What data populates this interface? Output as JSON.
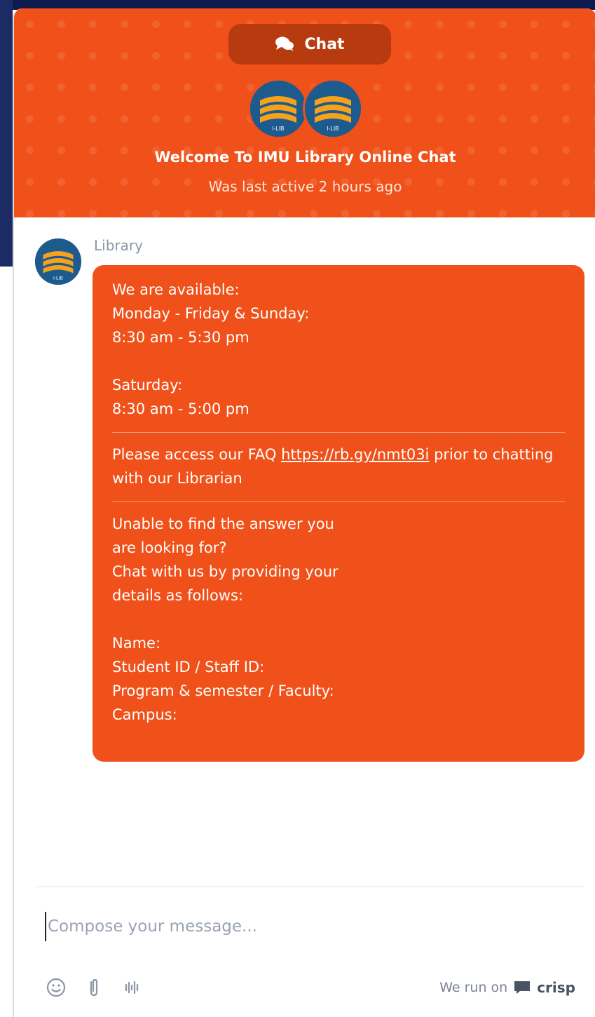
{
  "header": {
    "tab_label": "Chat",
    "title": "Welcome To IMU Library Online Chat",
    "status": "Was last active 2 hours ago",
    "accent": "#f05019"
  },
  "avatar_text": "I-LIB",
  "message": {
    "sender": "Library",
    "hours": "We are available:\nMonday - Friday & Sunday:\n8:30 am - 5:30 pm\n\nSaturday:\n8:30 am - 5:00 pm",
    "faq_prefix": "Please access our FAQ ",
    "faq_link": "https://rb.gy/nmt03i",
    "faq_suffix": " prior to chatting with our Librarian",
    "details": "Unable to find the answer you\nare looking for?\nChat with us by providing your\ndetails as follows:\n\nName:\nStudent ID / Staff ID:\nProgram & semester / Faculty:\nCampus:"
  },
  "compose": {
    "placeholder": "Compose your message..."
  },
  "toolbar": {
    "icons": [
      "smiley-icon",
      "paperclip-icon",
      "audio-wave-icon"
    ]
  },
  "footer": {
    "powered_prefix": "We run on",
    "brand": "crisp"
  }
}
